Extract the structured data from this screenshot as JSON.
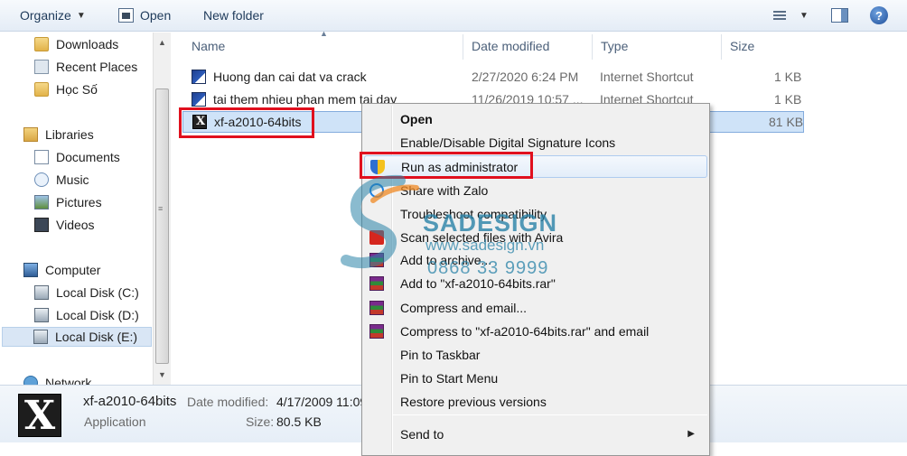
{
  "toolbar": {
    "organize_label": "Organize",
    "open_label": "Open",
    "new_folder_label": "New folder",
    "help_glyph": "?"
  },
  "nav": {
    "downloads": "Downloads",
    "recent_places": "Recent Places",
    "hoc_so": "Học Số",
    "libraries": "Libraries",
    "documents": "Documents",
    "music": "Music",
    "pictures": "Pictures",
    "videos": "Videos",
    "computer": "Computer",
    "disk_c": "Local Disk (C:)",
    "disk_d": "Local Disk (D:)",
    "disk_e": "Local Disk (E:)",
    "network": "Network"
  },
  "columns": {
    "name": "Name",
    "date_modified": "Date modified",
    "type": "Type",
    "size": "Size"
  },
  "files": [
    {
      "name": "Huong dan cai dat va crack",
      "date": "2/27/2020 6:24 PM",
      "type": "Internet Shortcut",
      "size": "1 KB"
    },
    {
      "name": "tai them nhieu phan mem tai day",
      "date": "11/26/2019 10:57 ...",
      "type": "Internet Shortcut",
      "size": "1 KB"
    },
    {
      "name": "xf-a2010-64bits",
      "date": "",
      "type": "",
      "size": "81 KB"
    }
  ],
  "details": {
    "filename": "xf-a2010-64bits",
    "filetype": "Application",
    "date_label": "Date modified:",
    "date_value": "4/17/2009 11:09",
    "size_label": "Size:",
    "size_value": "80.5 KB"
  },
  "context_menu": {
    "open": "Open",
    "signature": "Enable/Disable Digital Signature Icons",
    "run_admin": "Run as administrator",
    "share_zalo": "Share with Zalo",
    "troubleshoot": "Troubleshoot compatibility",
    "scan_avira": "Scan selected files with Avira",
    "add_archive": "Add to archive...",
    "add_rar": "Add to \"xf-a2010-64bits.rar\"",
    "compress_email": "Compress and email...",
    "compress_rar_email": "Compress to \"xf-a2010-64bits.rar\" and email",
    "pin_taskbar": "Pin to Taskbar",
    "pin_start": "Pin to Start Menu",
    "restore": "Restore previous versions",
    "send_to": "Send to"
  },
  "watermark": {
    "brand": "SADESIGN",
    "url": "www.sadesign.vn",
    "phone": "0868 33 9999"
  },
  "colors": {
    "highlight_red": "#e0101e",
    "selection_blue": "#cfe3f8",
    "watermark_teal": "#2a83a8"
  }
}
